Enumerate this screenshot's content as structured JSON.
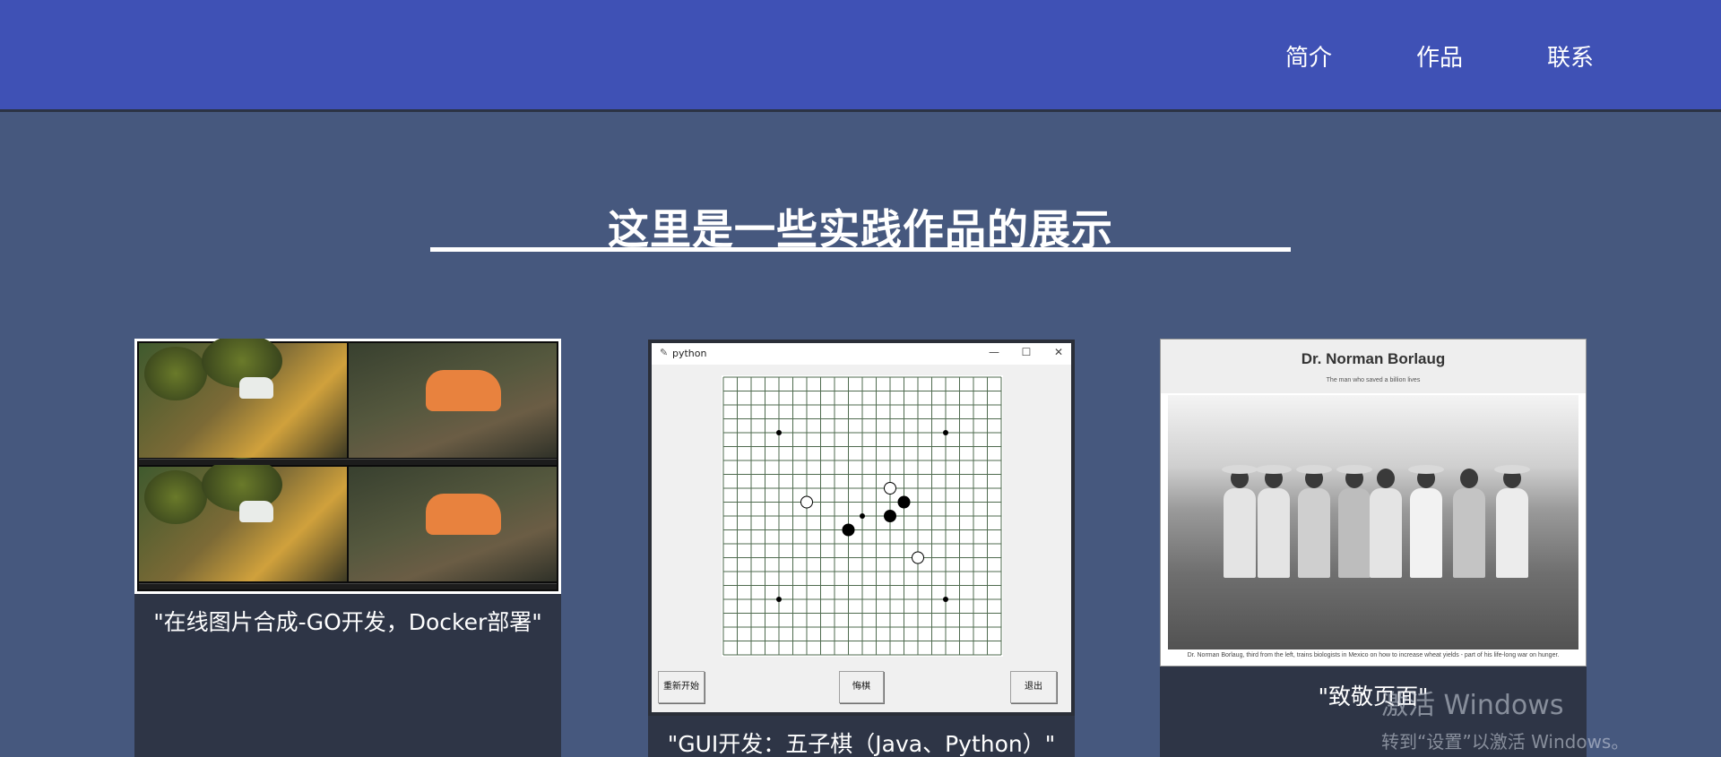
{
  "nav": {
    "items": [
      "简介",
      "作品",
      "联系"
    ]
  },
  "section": {
    "title": "这里是一些实践作品的展示"
  },
  "cards": [
    {
      "caption": "\"在线图片合成-GO开发，Docker部署\""
    },
    {
      "caption": "\"GUI开发：五子棋（Java、Python）\"",
      "window_title": "python",
      "buttons": [
        "重新开始",
        "悔棋",
        "退出"
      ],
      "controls": [
        "—",
        "☐",
        "✕"
      ]
    },
    {
      "caption": "\"致敬页面\"",
      "page_title": "Dr. Norman Borlaug",
      "page_subtitle": "The man who saved a billion lives",
      "photo_caption": "Dr. Norman Borlaug, third from the left, trains biologists in Mexico on how to increase wheat yields - part of his life-long war on hunger."
    }
  ],
  "board": {
    "size": 19,
    "hoshi": [
      [
        3,
        3
      ],
      [
        15,
        3
      ],
      [
        3,
        15
      ],
      [
        15,
        15
      ],
      [
        9,
        9
      ]
    ],
    "white_stones": [
      [
        5,
        8
      ],
      [
        11,
        7
      ],
      [
        13,
        12
      ]
    ],
    "black_stones": [
      [
        8,
        10
      ],
      [
        11,
        9
      ],
      [
        12,
        8
      ]
    ]
  },
  "watermark": {
    "line1": "激活 Windows",
    "line2": "转到“设置”以激活 Windows。"
  }
}
